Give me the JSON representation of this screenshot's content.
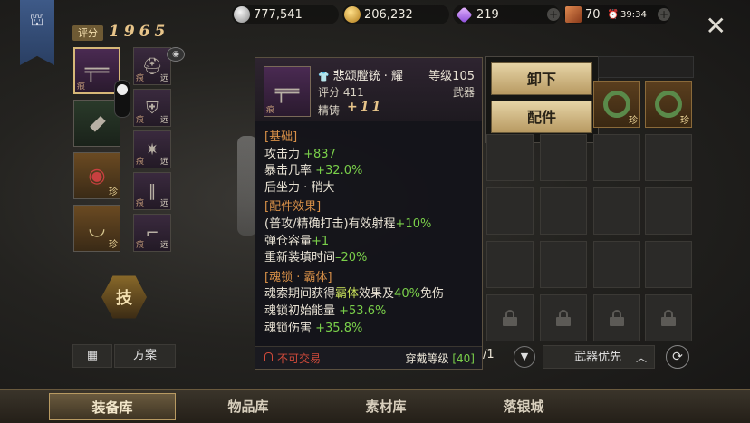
{
  "currencies": [
    {
      "icon": "silver-coin-icon",
      "value": "777,541"
    },
    {
      "icon": "gold-coin-icon",
      "value": "206,232"
    },
    {
      "icon": "diamond-icon",
      "value": "219"
    },
    {
      "icon": "stamina-book-icon",
      "value": "70",
      "timer": "39:34"
    }
  ],
  "header": {
    "score_label": "评分",
    "score_value": "1965"
  },
  "left_slots": {
    "tag_rare": "珍",
    "tag_far": "远",
    "tag_mark": "痕"
  },
  "skill": {
    "label": "技"
  },
  "left_buttons": {
    "plan_label": "方案"
  },
  "tooltip": {
    "name": "悲颂膛铳 · 耀",
    "level_label": "等级105",
    "score_label": "评分 411",
    "type_label": "武器",
    "refine_label": "精铸",
    "refine_value": "+11",
    "icon_tag": "痕",
    "sections": {
      "basic": "[基础]",
      "parts": "[配件效果]",
      "soul": "[魂锁 · 霸体]"
    },
    "basic_rows": [
      {
        "label": "攻击力 ",
        "value": "+837"
      },
      {
        "label": "暴击几率 ",
        "value": "+32.0%"
      },
      {
        "label": "后坐力 · 稍大",
        "value": ""
      }
    ],
    "parts_rows": [
      {
        "label": "(普攻/精确打击)有效射程",
        "value": "+10%"
      },
      {
        "label": "弹仓容量",
        "value": "+1"
      },
      {
        "label": "重新装填时间",
        "value": "–20%"
      }
    ],
    "soul_rows": [
      {
        "pre": "魂索期间获得",
        "hl": "霸体",
        "mid": "效果及",
        "val": "40%",
        "post": "免伤"
      },
      {
        "pre": "魂锁初始能量 ",
        "val": "+53.6%"
      },
      {
        "pre": "魂锁伤害 ",
        "val": "+35.8%"
      }
    ],
    "no_trade": "不可交易",
    "wear_label": "穿戴等级 ",
    "wear_value": "[40]"
  },
  "menu": {
    "unequip": "卸下",
    "parts": "配件"
  },
  "inventory": {
    "tag_rare": "珍",
    "page": "/1",
    "filter": "武器优先"
  },
  "tabs": [
    "装备库",
    "物品库",
    "素材库",
    "落银城"
  ],
  "colors": {
    "accent_gold": "#e8c58a",
    "stat_green": "#7ad04a",
    "section_orange": "#d89048",
    "warn_red": "#d04a3a"
  }
}
